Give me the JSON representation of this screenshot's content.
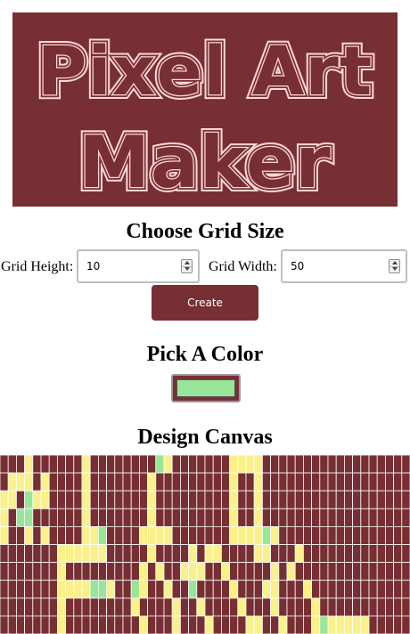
{
  "header": {
    "banner_line1": "Pixel Art",
    "banner_line2": "Maker"
  },
  "grid_size": {
    "heading": "Choose Grid Size",
    "height_label": "Grid Height:",
    "height_value": "10",
    "width_label": "Grid Width:",
    "width_value": "50",
    "create_label": "Create"
  },
  "color": {
    "heading": "Pick A Color",
    "current": "#98e698"
  },
  "canvas": {
    "heading": "Design Canvas",
    "rows": 10,
    "cols": 50,
    "background": "#772f34",
    "yellow": "#fbf18a",
    "green": "#98e698",
    "cells": [
      "...Y......Y........GY.......YYYY..................",
      ".YYY.Y....Y.......Y.........Y..Y..................",
      "YY.GYY....Y.......Y.........Y..Y..................",
      "Y.GG......Y.......Y.........Y..Y..................",
      "Y..Y.Y....YYG....YYYY.......YYYYGY................",
      ".......YYYYYY.....Y....Y.YY....YY...Y.............",
      ".......Y.........Y.Y..YYY..Y.....Y.Y..............",
      ".......YYYYGGY..GY..Y..G....Y...YY...Y............",
      ".......Y........Y....Y..Y....Y...Y....Y...........",
      ".......Y.........Y...Y...Y....YY..Y...YGYYYYY......"
    ]
  }
}
